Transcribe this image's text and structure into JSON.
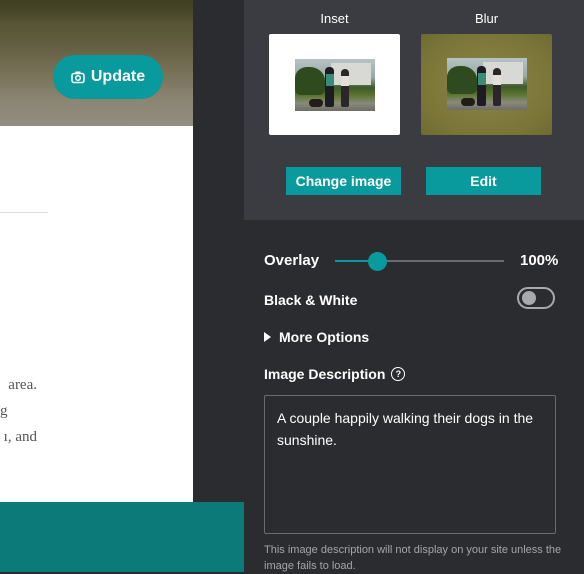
{
  "preview": {
    "update_button": "Update",
    "body_text": [
      "area.",
      "g",
      "ı, and"
    ]
  },
  "panel": {
    "styles": [
      {
        "label": "Inset"
      },
      {
        "label": "Blur"
      }
    ],
    "change_image_button": "Change image",
    "edit_button": "Edit",
    "overlay": {
      "label": "Overlay",
      "value_text": "100%",
      "level": 0.25
    },
    "black_white": {
      "label": "Black & White",
      "enabled": false
    },
    "more_options": "More Options",
    "image_description": {
      "label": "Image Description",
      "help_glyph": "?",
      "value": "A couple happily walking their dogs in the sunshine.",
      "hint": "This image description will not display on your site unless the image fails to load."
    }
  },
  "colors": {
    "accent": "#089a9c",
    "panel_bg": "#2b2c2f",
    "panel_top_bg": "#3b3c41",
    "footer": "#0b7a79"
  }
}
